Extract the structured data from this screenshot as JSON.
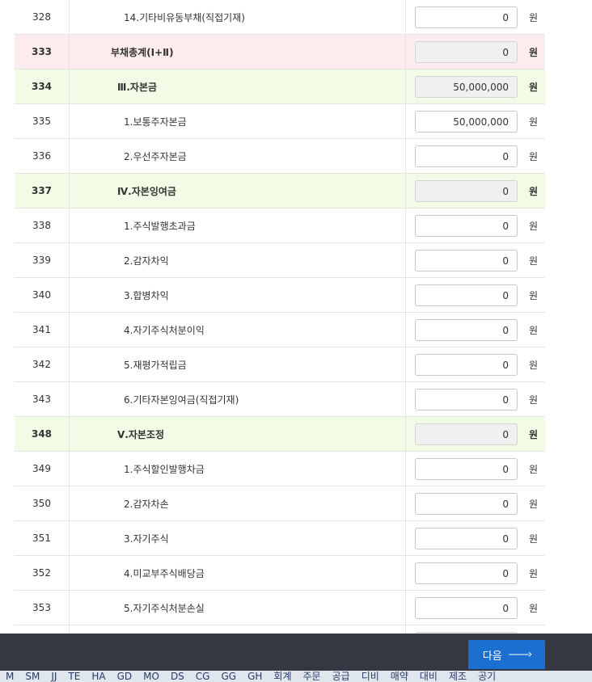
{
  "rows": [
    {
      "code": "328",
      "label": "14.기타비유동부채(직접기재)",
      "value": "0",
      "unit": "원",
      "style": "normal",
      "level": 2,
      "readonly": false
    },
    {
      "code": "333",
      "label": "부채총계(Ⅰ+Ⅱ)",
      "value": "0",
      "unit": "원",
      "style": "pink",
      "level": 0,
      "readonly": true
    },
    {
      "code": "334",
      "label": "Ⅲ.자본금",
      "value": "50,000,000",
      "unit": "원",
      "style": "green",
      "level": 1,
      "readonly": true
    },
    {
      "code": "335",
      "label": "1.보통주자본금",
      "value": "50,000,000",
      "unit": "원",
      "style": "normal",
      "level": 2,
      "readonly": false
    },
    {
      "code": "336",
      "label": "2.우선주자본금",
      "value": "0",
      "unit": "원",
      "style": "normal",
      "level": 2,
      "readonly": false
    },
    {
      "code": "337",
      "label": "Ⅳ.자본잉여금",
      "value": "0",
      "unit": "원",
      "style": "green",
      "level": 1,
      "readonly": true
    },
    {
      "code": "338",
      "label": "1.주식발행초과금",
      "value": "0",
      "unit": "원",
      "style": "normal",
      "level": 2,
      "readonly": false
    },
    {
      "code": "339",
      "label": "2.감자차익",
      "value": "0",
      "unit": "원",
      "style": "normal",
      "level": 2,
      "readonly": false
    },
    {
      "code": "340",
      "label": "3.합병차익",
      "value": "0",
      "unit": "원",
      "style": "normal",
      "level": 2,
      "readonly": false
    },
    {
      "code": "341",
      "label": "4.자기주식처분이익",
      "value": "0",
      "unit": "원",
      "style": "normal",
      "level": 2,
      "readonly": false
    },
    {
      "code": "342",
      "label": "5.재평가적립금",
      "value": "0",
      "unit": "원",
      "style": "normal",
      "level": 2,
      "readonly": false
    },
    {
      "code": "343",
      "label": "6.기타자본잉여금(직접기재)",
      "value": "0",
      "unit": "원",
      "style": "normal",
      "level": 2,
      "readonly": false
    },
    {
      "code": "348",
      "label": "Ⅴ.자본조정",
      "value": "0",
      "unit": "원",
      "style": "green",
      "level": 1,
      "readonly": true
    },
    {
      "code": "349",
      "label": "1.주식할인발행차금",
      "value": "0",
      "unit": "원",
      "style": "normal",
      "level": 2,
      "readonly": false
    },
    {
      "code": "350",
      "label": "2.감자차손",
      "value": "0",
      "unit": "원",
      "style": "normal",
      "level": 2,
      "readonly": false
    },
    {
      "code": "351",
      "label": "3.자기주식",
      "value": "0",
      "unit": "원",
      "style": "normal",
      "level": 2,
      "readonly": false
    },
    {
      "code": "352",
      "label": "4.미교부주식배당금",
      "value": "0",
      "unit": "원",
      "style": "normal",
      "level": 2,
      "readonly": false
    },
    {
      "code": "353",
      "label": "5.자기주식처분손실",
      "value": "0",
      "unit": "원",
      "style": "normal",
      "level": 2,
      "readonly": false
    }
  ],
  "footer": {
    "next_label": "다음",
    "arrow_icon": "long-arrow-right-icon",
    "background_color": "#353743",
    "button_color": "#1a6fd1"
  },
  "bottom_strip": {
    "items": [
      "M",
      "SM",
      "JJ",
      "TE",
      "HA",
      "GD",
      "MO",
      "DS",
      "CG",
      "GG",
      "GH",
      "회계",
      "주문",
      "공급",
      "디비",
      "매약",
      "대비",
      "제조",
      "공기"
    ]
  }
}
